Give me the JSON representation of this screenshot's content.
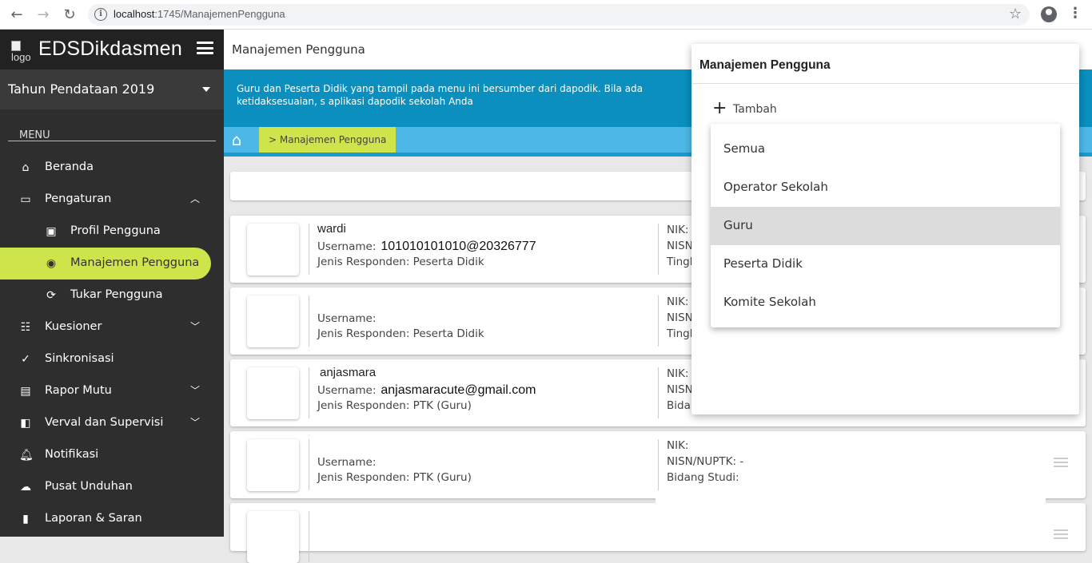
{
  "browser": {
    "url_host": "localhost",
    "url_path": ":1745/ManajemenPengguna"
  },
  "sidebar": {
    "logo_alt": "logo",
    "brand": "EDSDikdasmen",
    "year_select": "Tahun Pendataan 2019",
    "menu_header": "MENU",
    "items": [
      {
        "label": "Beranda",
        "icon": "home-icon"
      },
      {
        "label": "Pengaturan",
        "icon": "monitor-icon"
      },
      {
        "label": "Profil Pengguna",
        "icon": "profile-card-icon"
      },
      {
        "label": "Manajemen Pengguna",
        "icon": "user-circle-icon"
      },
      {
        "label": "Tukar Pengguna",
        "icon": "sync-icon"
      },
      {
        "label": "Kuesioner",
        "icon": "questionnaire-icon"
      },
      {
        "label": "Sinkronisasi",
        "icon": "check-circle-icon"
      },
      {
        "label": "Rapor Mutu",
        "icon": "book-icon"
      },
      {
        "label": "Verval dan Supervisi",
        "icon": "verify-icon"
      },
      {
        "label": "Notifikasi",
        "icon": "bell-icon"
      },
      {
        "label": "Pusat Unduhan",
        "icon": "cloud-download-icon"
      },
      {
        "label": "Laporan & Saran",
        "icon": "report-icon"
      }
    ]
  },
  "main": {
    "page_title": "Manajemen Pengguna",
    "info_text": "Guru dan Peserta Didik yang tampil pada menu ini bersumber dari dapodik. Bila ada ketidaksesuaian, s aplikasi dapodik sekolah Anda",
    "breadcrumb": "> Manajemen Pengguna",
    "users": [
      {
        "name": "wardi",
        "username_label": "Username:",
        "username": "101010101010@20326777",
        "jenis": "Jenis Responden: Peserta Didik",
        "r1": "NIK:",
        "r2": "NISN",
        "r3": "Tingk"
      },
      {
        "name": "",
        "username_label": "Username:",
        "username": "",
        "jenis": "Jenis Responden: Peserta Didik",
        "r1": "NIK:",
        "r2": "NISN",
        "r3": "Tingk"
      },
      {
        "name": "anjasmara",
        "username_label": "Username:",
        "username": "anjasmaracute@gmail.com",
        "jenis": "Jenis Responden: PTK (Guru)",
        "r1": "NIK:",
        "r2": "NISN",
        "r3": "Bidan"
      },
      {
        "name": "",
        "username_label": "Username:",
        "username": "",
        "jenis": "Jenis Responden: PTK (Guru)",
        "r1": "NIK:",
        "r2": "NISN/NUPTK: -",
        "r3": "Bidang Studi:"
      }
    ]
  },
  "popup": {
    "title": "Manajemen Pengguna",
    "add_label": "Tambah",
    "options": [
      "Semua",
      "Operator Sekolah",
      "Guru",
      "Peserta Didik",
      "Komite Sekolah"
    ],
    "selected": "Guru"
  },
  "colors": {
    "sidebar_bg": "#2e2e2e",
    "accent_lime": "#cde44b",
    "banner_blue": "#0a8fbf",
    "crumb_blue": "#4db8e8"
  }
}
